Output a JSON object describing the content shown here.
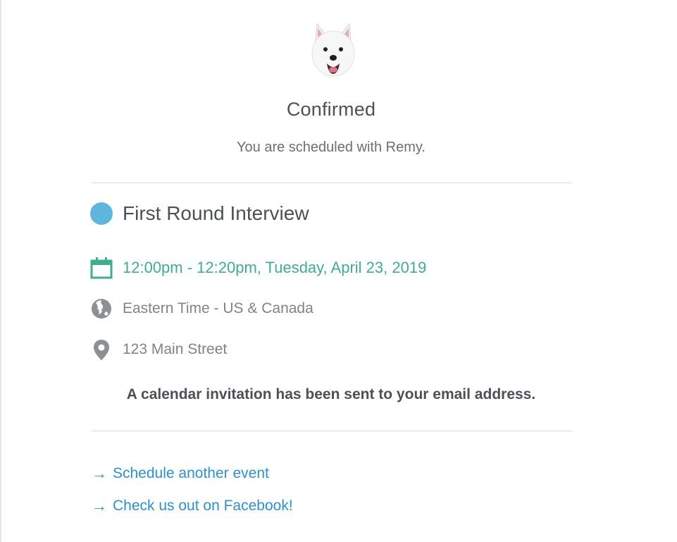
{
  "confirmation": {
    "title": "Confirmed",
    "subtitle": "You are scheduled with Remy."
  },
  "event": {
    "name": "First Round Interview",
    "dot_color": "#5fb6dd",
    "datetime": "12:00pm - 12:20pm, Tuesday, April 23, 2019",
    "timezone": "Eastern Time - US & Canada",
    "location": "123 Main Street"
  },
  "notice": "A calendar invitation has been sent to your email address.",
  "links": [
    {
      "label": "Schedule another event",
      "icon": "arrow-right-icon"
    },
    {
      "label": "Check us out on Facebook!",
      "icon": "arrow-right-icon"
    }
  ],
  "icons": {
    "avatar": "dog-avatar",
    "calendar": "calendar-icon",
    "timezone": "globe-icon",
    "location": "map-pin-icon"
  },
  "colors": {
    "accent_green": "#3fae8e",
    "link_blue": "#2d90d6"
  }
}
